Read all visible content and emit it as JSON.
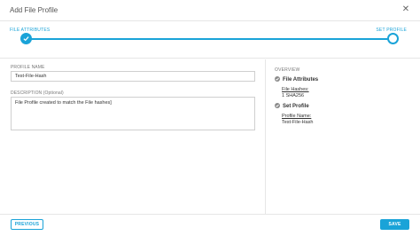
{
  "header": {
    "title": "Add File Profile",
    "close_icon": "close-icon"
  },
  "stepper": {
    "steps": [
      {
        "label": "FILE ATTRIBUTES",
        "state": "done"
      },
      {
        "label": "SET PROFILE",
        "state": "current"
      }
    ]
  },
  "form": {
    "profile_name_label": "PROFILE NAME",
    "profile_name_value": "Test-File-Hash",
    "description_label": "DESCRIPTION (Optional)",
    "description_value": "File Profile created to match the File hashes]"
  },
  "overview": {
    "title": "OVERVIEW",
    "sections": [
      {
        "title": "File Attributes",
        "key": "File Hashes:",
        "value": "1 SHA256"
      },
      {
        "title": "Set Profile",
        "key": "Profile Name:",
        "value": "Test-File-Hash"
      }
    ]
  },
  "footer": {
    "previous_label": "PREVIOUS",
    "save_label": "SAVE"
  },
  "colors": {
    "accent": "#1aa3d8",
    "border": "#e6e6e6",
    "text": "#333333"
  }
}
